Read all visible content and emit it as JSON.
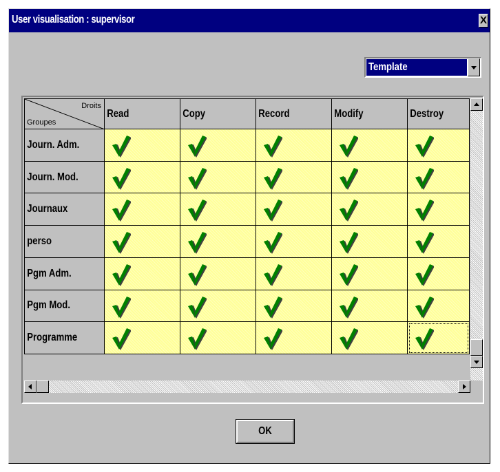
{
  "window": {
    "title": "User visualisation : supervisor",
    "close_label": "X"
  },
  "template_select": {
    "value": "Template"
  },
  "grid": {
    "corner": {
      "droits_label": "Droits",
      "groupes_label": "Groupes"
    },
    "columns": [
      "Read",
      "Copy",
      "Record",
      "Modify",
      "Destroy"
    ],
    "rows": [
      {
        "label": "Journ. Adm.",
        "checked": [
          true,
          true,
          true,
          true,
          true
        ]
      },
      {
        "label": "Journ. Mod.",
        "checked": [
          true,
          true,
          true,
          true,
          true
        ]
      },
      {
        "label": "Journaux",
        "checked": [
          true,
          true,
          true,
          true,
          true
        ]
      },
      {
        "label": "perso",
        "checked": [
          true,
          true,
          true,
          true,
          true
        ]
      },
      {
        "label": "Pgm Adm.",
        "checked": [
          true,
          true,
          true,
          true,
          true
        ]
      },
      {
        "label": "Pgm Mod.",
        "checked": [
          true,
          true,
          true,
          true,
          true
        ]
      },
      {
        "label": "Programme",
        "checked": [
          true,
          true,
          true,
          true,
          true
        ]
      }
    ],
    "check_icon": "checkmark-icon",
    "cell_color": "#ffff99",
    "check_color": "#008000"
  },
  "buttons": {
    "ok_label": "OK"
  },
  "colors": {
    "titlebar": "#000080",
    "face": "#c0c0c0"
  }
}
